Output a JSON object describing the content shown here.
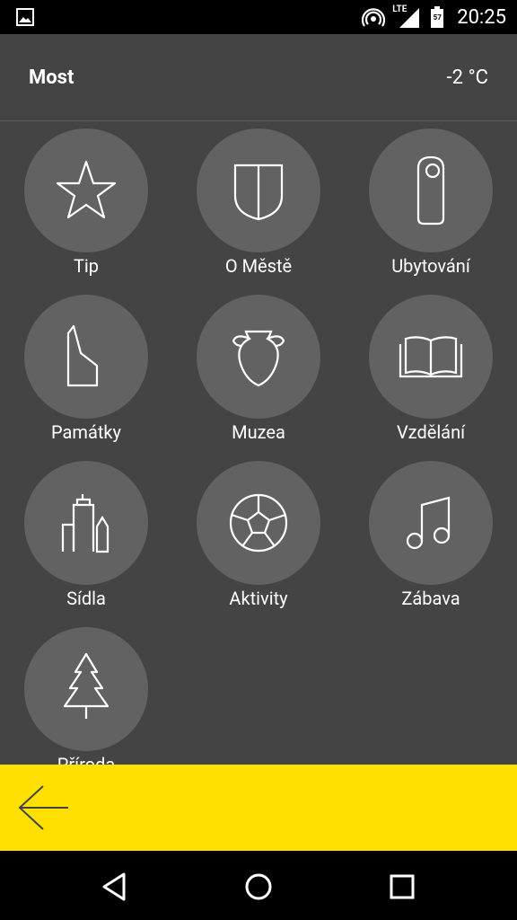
{
  "status_bar": {
    "network": "LTE",
    "battery_level": "57",
    "time": "20:25"
  },
  "header": {
    "city": "Most",
    "temperature": "-2 °C"
  },
  "categories": [
    {
      "label": "Tip",
      "icon": "star-icon"
    },
    {
      "label": "O Městě",
      "icon": "shield-icon"
    },
    {
      "label": "Ubytování",
      "icon": "door-hanger-icon"
    },
    {
      "label": "Památky",
      "icon": "monument-icon"
    },
    {
      "label": "Muzea",
      "icon": "amphora-icon"
    },
    {
      "label": "Vzdělání",
      "icon": "book-icon"
    },
    {
      "label": "Sídla",
      "icon": "buildings-icon"
    },
    {
      "label": "Aktivity",
      "icon": "football-icon"
    },
    {
      "label": "Zábava",
      "icon": "music-note-icon"
    },
    {
      "label": "Příroda",
      "icon": "tree-icon"
    }
  ],
  "colors": {
    "background": "#444444",
    "circle": "#626262",
    "accent_bar": "#FFE000",
    "icon_stroke": "#ffffff"
  }
}
